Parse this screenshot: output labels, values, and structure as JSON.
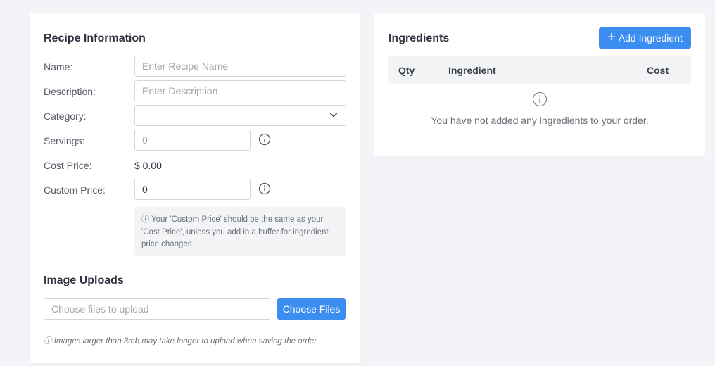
{
  "recipe_info": {
    "title": "Recipe Information",
    "name_label": "Name:",
    "name_placeholder": "Enter Recipe Name",
    "description_label": "Description:",
    "description_placeholder": "Enter Description",
    "category_label": "Category:",
    "category_value": "",
    "servings_label": "Servings:",
    "servings_placeholder": "0",
    "cost_price_label": "Cost Price:",
    "cost_price_value": "$ 0.00",
    "custom_price_label": "Custom Price:",
    "custom_price_value": "0",
    "custom_price_hint": "Your 'Custom Price' should be the same as your 'Cost Price', unless you add in a buffer for ingredient price changes."
  },
  "image_uploads": {
    "title": "Image Uploads",
    "file_placeholder": "Choose files to upload",
    "choose_button": "Choose Files",
    "note": "Images larger than 3mb may take longer to upload when saving the order."
  },
  "ingredients": {
    "title": "Ingredients",
    "add_button": "Add Ingredient",
    "columns": [
      "Qty",
      "Ingredient",
      "Cost"
    ],
    "empty_message": "You have not added any ingredients to your order."
  },
  "colors": {
    "accent": "#3b8ef0",
    "background": "#f3f4f7"
  },
  "icons": {
    "info": "info-circle-icon",
    "chevron": "chevron-down-icon",
    "plus": "plus-icon"
  }
}
